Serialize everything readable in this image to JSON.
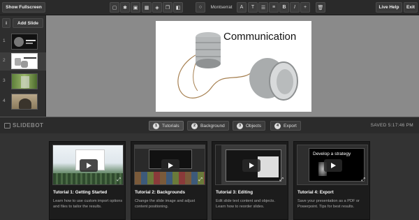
{
  "toolbar": {
    "show_fullscreen": "Show Fullscreen",
    "font": "Montserrat",
    "live_help": "Live Help",
    "exit": "Exit"
  },
  "sidebar": {
    "info": "i",
    "add_slide": "Add Slide",
    "slides": [
      {
        "num": "1"
      },
      {
        "num": "2"
      },
      {
        "num": "3"
      },
      {
        "num": "4"
      }
    ]
  },
  "slide": {
    "title": "Communication"
  },
  "bottom": {
    "brand": "SLIDEBOT",
    "saved": "SAVED 5:17:46 PM",
    "tabs": [
      {
        "num": "1",
        "label": "Tutorials"
      },
      {
        "num": "2",
        "label": "Background"
      },
      {
        "num": "3",
        "label": "Objects"
      },
      {
        "num": "4",
        "label": "Export"
      }
    ]
  },
  "cards": [
    {
      "title": "Tutorial 1: Getting Started",
      "desc": "Learn how to use custom import options and files to tailor the results."
    },
    {
      "title": "Tutorial 2: Backgrounds",
      "desc": "Change the slide image and adjust content positioning."
    },
    {
      "title": "Tutorial 3: Editing",
      "desc": "Edit slide text content and objects. Learn how to reorder slides."
    },
    {
      "title": "Tutorial 4: Export",
      "desc": "Save your presentation as a PDF or Powerpoint. Tips for best results.",
      "shot_text": "Develop a strategy"
    }
  ],
  "colors": {
    "toolbar": "#2a2a2a",
    "canvas": "#8a8a8a",
    "card": "#1c1c1c"
  }
}
